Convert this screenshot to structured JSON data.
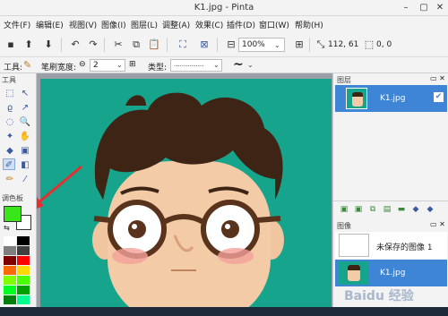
{
  "window": {
    "title": "K1.jpg - Pinta"
  },
  "menu": [
    "文件(F)",
    "编辑(E)",
    "视图(V)",
    "图像(I)",
    "图层(L)",
    "调整(A)",
    "效果(C)",
    "插件(D)",
    "窗口(W)",
    "帮助(H)"
  ],
  "toolbar": {
    "zoom_value": "100%",
    "cursor_pos": "112, 61",
    "selection_size": "0, 0"
  },
  "options": {
    "tool_label": "工具:",
    "brush_width_label": "笔刷宽度:",
    "brush_width_value": "2",
    "type_label": "类型:",
    "type_value": "...............",
    "antialias_icon": "~"
  },
  "tools_panel": {
    "header": "工具",
    "palette_header": "调色板"
  },
  "layers_panel": {
    "header": "图层",
    "layer_name": "K1.jpg",
    "visible_check": "✔"
  },
  "history_panel": {
    "header": "图像",
    "unsaved_item": "未保存的图像 1",
    "current_item": "K1.jpg"
  },
  "colors": {
    "primary": "#39e61a",
    "secondary": "#ffffff",
    "canvas_bg": "#17a48c",
    "accent": "#3f85d6"
  },
  "palette": [
    "#ffffff",
    "#000000",
    "#7f7f7f",
    "#404040",
    "#7f0000",
    "#ff0000",
    "#ff6a00",
    "#ffd800",
    "#7fff00",
    "#4cff00",
    "#00ff21",
    "#00a000",
    "#007f0e",
    "#00ff90"
  ],
  "watermark": "Baidu 经验"
}
